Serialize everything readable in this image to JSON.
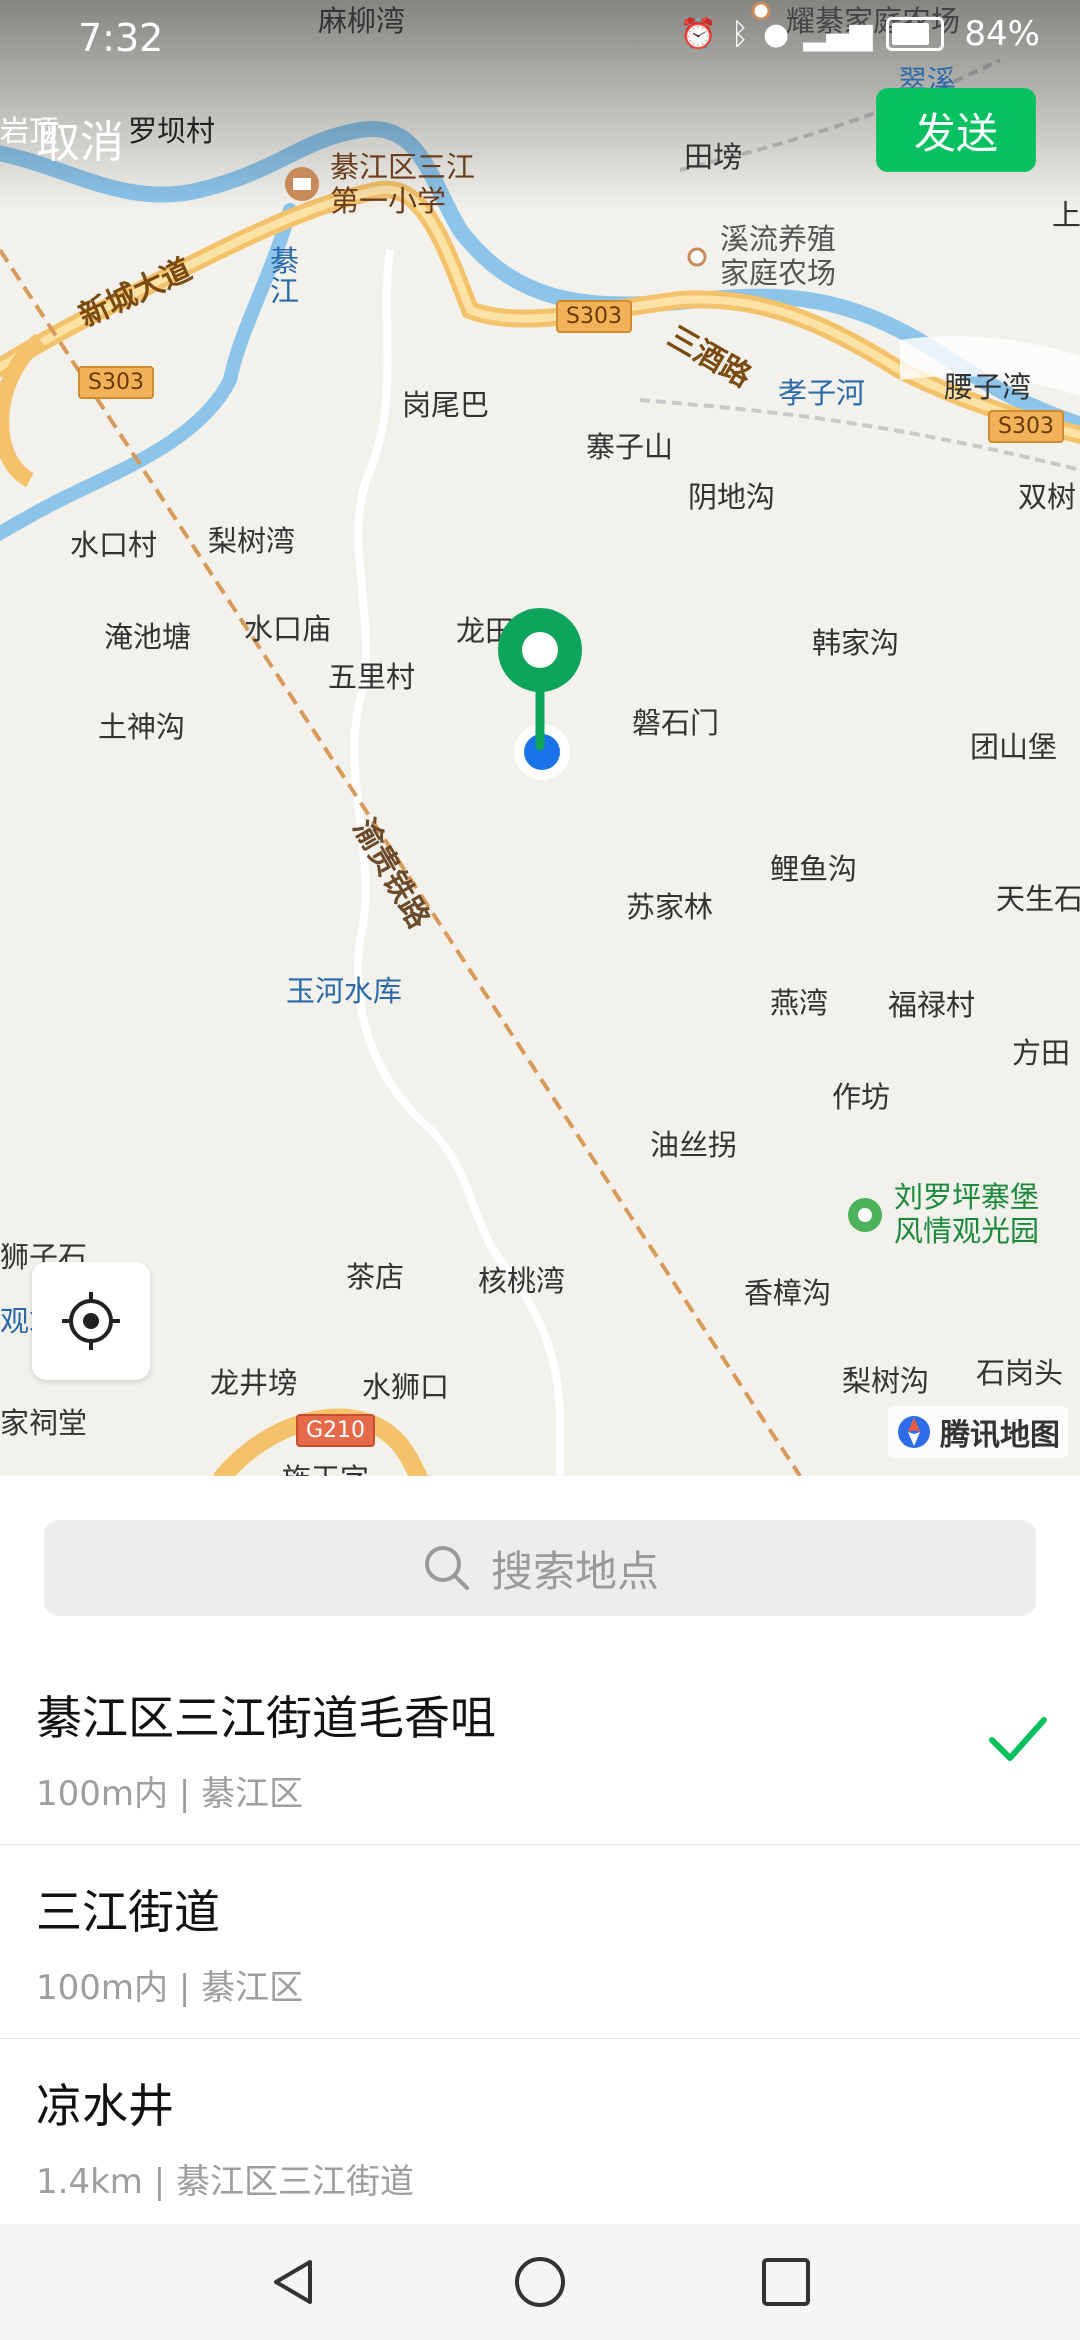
{
  "status_bar": {
    "time": "7:32",
    "battery": "84%"
  },
  "header": {
    "cancel_label": "取消",
    "send_label": "发送"
  },
  "map": {
    "labels": {
      "malewan": "麻柳湾",
      "yaoji_farm": "耀綦家庭农场",
      "cuixi": "翠溪",
      "yanding": "岩顶",
      "luobacun": "罗坝村",
      "school": "綦江区三江\n第一小学",
      "tianbang": "田塝",
      "xiliu_farm": "溪流养殖\n家庭农场",
      "shang": "上",
      "xincheng_road": "新城大道",
      "qijiang": "綦\n江",
      "sanqiu_road": "三酒路",
      "xiaozihe": "孝子河",
      "yaoziwan": "腰子湾",
      "gangweiba": "岗尾巴",
      "zhaizishan": "寨子山",
      "yindigou": "阴地沟",
      "shuangshu": "双树",
      "shuikoucun": "水口村",
      "lishuwan1": "梨树湾",
      "yanchitang": "淹池塘",
      "shuikoumiao": "水口庙",
      "longtian": "龙田",
      "wulicun": "五里村",
      "hanjiagou": "韩家沟",
      "tushengou": "土神沟",
      "panshimen": "磐石门",
      "tuanshanbao": "团山堡",
      "yuyugou": "鲤鱼沟",
      "sujialin": "苏家林",
      "tiansheng": "天生石",
      "railway": "渝贵铁路",
      "yuhe_reservoir": "玉河水库",
      "yanwan": "燕湾",
      "fulucun": "福禄村",
      "fangtian": "方田",
      "zuofang": "作坊",
      "yousiguai": "油丝拐",
      "scenic": "刘罗坪寨堡\n风情观光园",
      "shizishi": "狮子石",
      "zhan": "观站",
      "chadian": "茶店",
      "hetaowan": "核桃湾",
      "xiangzhanggou": "香樟沟",
      "lishugou": "梨树沟",
      "shigangtou": "石岗头",
      "longjingbang": "龙井塝",
      "shuishikou": "水狮口",
      "cijiatang": "家祠堂",
      "bottom_cut": "旌王字"
    },
    "shields": {
      "s303_a": "S303",
      "s303_b": "S303",
      "s303_c": "S303",
      "g210": "G210"
    },
    "logo_text": "腾讯地图"
  },
  "search": {
    "placeholder": "搜索地点"
  },
  "results": [
    {
      "name": "綦江区三江街道毛香咀",
      "detail": "100m内 | 綦江区",
      "selected": true
    },
    {
      "name": "三江街道",
      "detail": "100m内 | 綦江区",
      "selected": false
    },
    {
      "name": "凉水井",
      "detail": "1.4km | 綦江区三江街道",
      "selected": false
    }
  ],
  "colors": {
    "accent": "#07c160",
    "pin": "#0ea55a",
    "location_dot": "#1a73e8",
    "railway": "#d79a5a",
    "road": "#f3c26b",
    "river": "#8cc4ea"
  }
}
